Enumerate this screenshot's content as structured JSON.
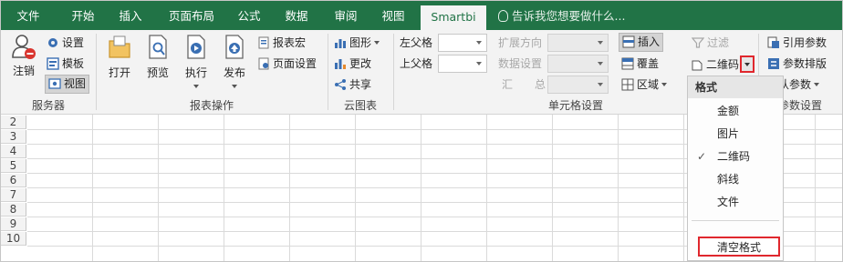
{
  "tabs": [
    "文件",
    "开始",
    "插入",
    "页面布局",
    "公式",
    "数据",
    "审阅",
    "视图",
    "Smartbi"
  ],
  "tell_me": "告诉我您想要做什么...",
  "groups": {
    "server": {
      "label": "服务器",
      "logout": "注销",
      "settings": "设置",
      "template": "模板",
      "view": "视图"
    },
    "report": {
      "label": "报表操作",
      "open": "打开",
      "preview": "预览",
      "run": "执行",
      "publish": "发布",
      "macro": "报表宏",
      "page_setup": "页面设置"
    },
    "cloud": {
      "label": "云图表",
      "chart": "图形",
      "change": "更改",
      "share": "共享"
    },
    "cell": {
      "label": "单元格设置",
      "left_parent": "左父格",
      "top_parent": "上父格",
      "expand_dir": "扩展方向",
      "data_setting": "数据设置",
      "aggregate": "汇　　总",
      "insert": "插入",
      "cover": "覆盖",
      "region": "区域",
      "filter": "过滤",
      "qrcode": "二维码"
    },
    "params": {
      "label": "参数设置",
      "ref_param": "引用参数",
      "param_layout": "参数排版",
      "default_param": "默认参数"
    }
  },
  "rows": [
    "2",
    "3",
    "4",
    "5",
    "6",
    "7",
    "8",
    "9",
    "10"
  ],
  "menu": {
    "header": "格式",
    "items": [
      "金额",
      "图片",
      "二维码",
      "斜线",
      "文件"
    ],
    "checked_index": 2,
    "clear": "清空格式"
  },
  "colors": {
    "brand": "#217346",
    "highlight": "#e0272d"
  }
}
